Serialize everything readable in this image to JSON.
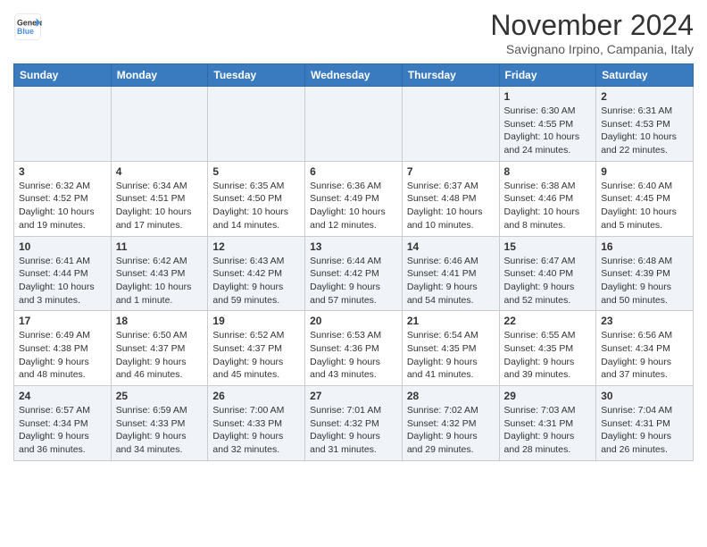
{
  "header": {
    "logo_line1": "General",
    "logo_line2": "Blue",
    "month_title": "November 2024",
    "location": "Savignano Irpino, Campania, Italy"
  },
  "days_of_week": [
    "Sunday",
    "Monday",
    "Tuesday",
    "Wednesday",
    "Thursday",
    "Friday",
    "Saturday"
  ],
  "weeks": [
    [
      {
        "day": "",
        "info": ""
      },
      {
        "day": "",
        "info": ""
      },
      {
        "day": "",
        "info": ""
      },
      {
        "day": "",
        "info": ""
      },
      {
        "day": "",
        "info": ""
      },
      {
        "day": "1",
        "info": "Sunrise: 6:30 AM\nSunset: 4:55 PM\nDaylight: 10 hours and 24 minutes."
      },
      {
        "day": "2",
        "info": "Sunrise: 6:31 AM\nSunset: 4:53 PM\nDaylight: 10 hours and 22 minutes."
      }
    ],
    [
      {
        "day": "3",
        "info": "Sunrise: 6:32 AM\nSunset: 4:52 PM\nDaylight: 10 hours and 19 minutes."
      },
      {
        "day": "4",
        "info": "Sunrise: 6:34 AM\nSunset: 4:51 PM\nDaylight: 10 hours and 17 minutes."
      },
      {
        "day": "5",
        "info": "Sunrise: 6:35 AM\nSunset: 4:50 PM\nDaylight: 10 hours and 14 minutes."
      },
      {
        "day": "6",
        "info": "Sunrise: 6:36 AM\nSunset: 4:49 PM\nDaylight: 10 hours and 12 minutes."
      },
      {
        "day": "7",
        "info": "Sunrise: 6:37 AM\nSunset: 4:48 PM\nDaylight: 10 hours and 10 minutes."
      },
      {
        "day": "8",
        "info": "Sunrise: 6:38 AM\nSunset: 4:46 PM\nDaylight: 10 hours and 8 minutes."
      },
      {
        "day": "9",
        "info": "Sunrise: 6:40 AM\nSunset: 4:45 PM\nDaylight: 10 hours and 5 minutes."
      }
    ],
    [
      {
        "day": "10",
        "info": "Sunrise: 6:41 AM\nSunset: 4:44 PM\nDaylight: 10 hours and 3 minutes."
      },
      {
        "day": "11",
        "info": "Sunrise: 6:42 AM\nSunset: 4:43 PM\nDaylight: 10 hours and 1 minute."
      },
      {
        "day": "12",
        "info": "Sunrise: 6:43 AM\nSunset: 4:42 PM\nDaylight: 9 hours and 59 minutes."
      },
      {
        "day": "13",
        "info": "Sunrise: 6:44 AM\nSunset: 4:42 PM\nDaylight: 9 hours and 57 minutes."
      },
      {
        "day": "14",
        "info": "Sunrise: 6:46 AM\nSunset: 4:41 PM\nDaylight: 9 hours and 54 minutes."
      },
      {
        "day": "15",
        "info": "Sunrise: 6:47 AM\nSunset: 4:40 PM\nDaylight: 9 hours and 52 minutes."
      },
      {
        "day": "16",
        "info": "Sunrise: 6:48 AM\nSunset: 4:39 PM\nDaylight: 9 hours and 50 minutes."
      }
    ],
    [
      {
        "day": "17",
        "info": "Sunrise: 6:49 AM\nSunset: 4:38 PM\nDaylight: 9 hours and 48 minutes."
      },
      {
        "day": "18",
        "info": "Sunrise: 6:50 AM\nSunset: 4:37 PM\nDaylight: 9 hours and 46 minutes."
      },
      {
        "day": "19",
        "info": "Sunrise: 6:52 AM\nSunset: 4:37 PM\nDaylight: 9 hours and 45 minutes."
      },
      {
        "day": "20",
        "info": "Sunrise: 6:53 AM\nSunset: 4:36 PM\nDaylight: 9 hours and 43 minutes."
      },
      {
        "day": "21",
        "info": "Sunrise: 6:54 AM\nSunset: 4:35 PM\nDaylight: 9 hours and 41 minutes."
      },
      {
        "day": "22",
        "info": "Sunrise: 6:55 AM\nSunset: 4:35 PM\nDaylight: 9 hours and 39 minutes."
      },
      {
        "day": "23",
        "info": "Sunrise: 6:56 AM\nSunset: 4:34 PM\nDaylight: 9 hours and 37 minutes."
      }
    ],
    [
      {
        "day": "24",
        "info": "Sunrise: 6:57 AM\nSunset: 4:34 PM\nDaylight: 9 hours and 36 minutes."
      },
      {
        "day": "25",
        "info": "Sunrise: 6:59 AM\nSunset: 4:33 PM\nDaylight: 9 hours and 34 minutes."
      },
      {
        "day": "26",
        "info": "Sunrise: 7:00 AM\nSunset: 4:33 PM\nDaylight: 9 hours and 32 minutes."
      },
      {
        "day": "27",
        "info": "Sunrise: 7:01 AM\nSunset: 4:32 PM\nDaylight: 9 hours and 31 minutes."
      },
      {
        "day": "28",
        "info": "Sunrise: 7:02 AM\nSunset: 4:32 PM\nDaylight: 9 hours and 29 minutes."
      },
      {
        "day": "29",
        "info": "Sunrise: 7:03 AM\nSunset: 4:31 PM\nDaylight: 9 hours and 28 minutes."
      },
      {
        "day": "30",
        "info": "Sunrise: 7:04 AM\nSunset: 4:31 PM\nDaylight: 9 hours and 26 minutes."
      }
    ]
  ]
}
